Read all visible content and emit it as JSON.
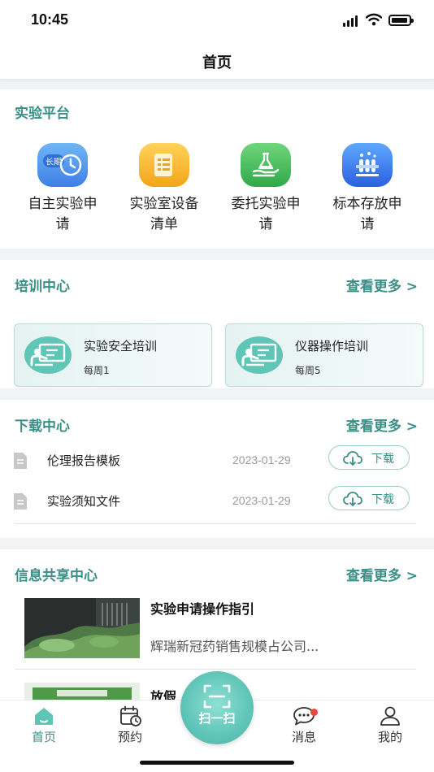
{
  "status_bar": {
    "time": "10:45"
  },
  "nav": {
    "title": "首页"
  },
  "platform": {
    "title": "实验平台",
    "items": [
      {
        "label_line1": "自主实验申",
        "label_line2": "请",
        "icon": "clock-icon",
        "badge": "长期"
      },
      {
        "label_line1": "实验室设备",
        "label_line2": "清单",
        "icon": "list-icon"
      },
      {
        "label_line1": "委托实验申",
        "label_line2": "请",
        "icon": "flask-hand-icon"
      },
      {
        "label_line1": "标本存放申",
        "label_line2": "请",
        "icon": "test-tube-rack-icon"
      }
    ]
  },
  "training": {
    "title": "培训中心",
    "more": "查看更多 >",
    "items": [
      {
        "title": "实验安全培训",
        "schedule": "每周1"
      },
      {
        "title": "仪器操作培训",
        "schedule": "每周5"
      }
    ]
  },
  "downloads": {
    "title": "下载中心",
    "more": "查看更多 >",
    "button_label": "下载",
    "items": [
      {
        "name": "伦理报告模板",
        "date": "2023-01-29"
      },
      {
        "name": "实验须知文件",
        "date": "2023-01-29"
      }
    ]
  },
  "news": {
    "title": "信息共享中心",
    "more": "查看更多 >",
    "items": [
      {
        "title": "实验申请操作指引",
        "subtitle": "辉瑞新冠药销售规模占公司..."
      },
      {
        "title": "放假"
      }
    ]
  },
  "tabbar": {
    "items": [
      {
        "label": "首页",
        "icon": "home-icon",
        "active": true
      },
      {
        "label": "预约",
        "icon": "calendar-clock-icon"
      },
      {
        "label": "消息",
        "icon": "chat-bubble-icon",
        "has_badge": true
      },
      {
        "label": "我的",
        "icon": "user-icon"
      }
    ],
    "scan_label": "扫一扫"
  },
  "colors": {
    "accent": "#3a8f86",
    "accent_light": "#5ec5b7",
    "badge": "#e8463f"
  }
}
